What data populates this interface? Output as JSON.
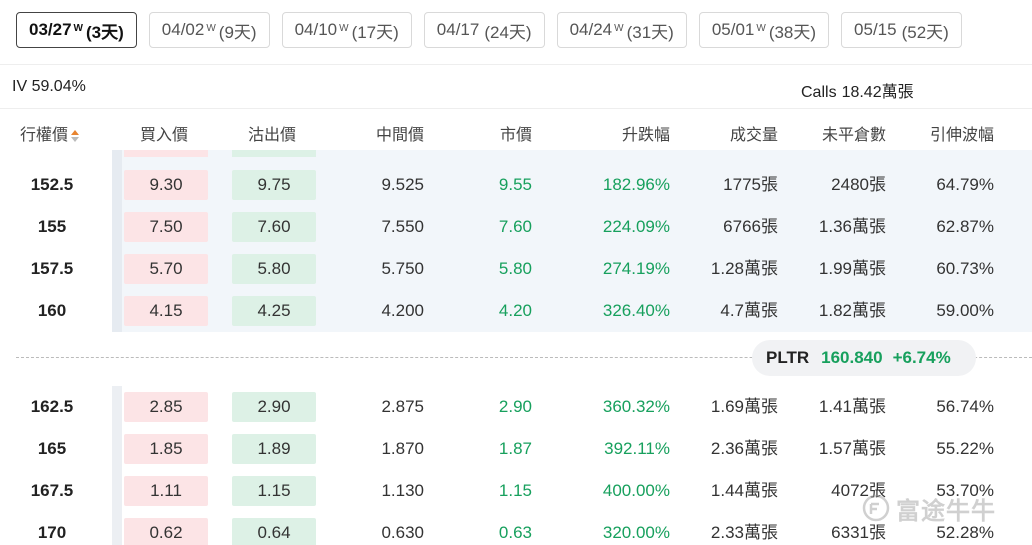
{
  "expiry_tabs": [
    {
      "date": "03/27",
      "weekly": "W",
      "days": "(3天)",
      "active": true
    },
    {
      "date": "04/02",
      "weekly": "W",
      "days": "(9天)",
      "active": false
    },
    {
      "date": "04/10",
      "weekly": "W",
      "days": "(17天)",
      "active": false
    },
    {
      "date": "04/17",
      "weekly": "",
      "days": "(24天)",
      "active": false
    },
    {
      "date": "04/24",
      "weekly": "W",
      "days": "(31天)",
      "active": false
    },
    {
      "date": "05/01",
      "weekly": "W",
      "days": "(38天)",
      "active": false
    },
    {
      "date": "05/15",
      "weekly": "",
      "days": "(52天)",
      "active": false
    }
  ],
  "summary": {
    "iv": "IV 59.04%",
    "calls_label": "Calls",
    "calls_value": "18.42萬張"
  },
  "columns": {
    "strike": "行權價",
    "bid": "買入價",
    "ask": "沽出價",
    "mid": "中間價",
    "last": "市價",
    "change": "升跌幅",
    "volume": "成交量",
    "open_interest": "未平倉數",
    "implied_vol": "引伸波幅"
  },
  "rows_above": [
    {
      "strike": "152.5",
      "bid": "9.30",
      "ask": "9.75",
      "mid": "9.525",
      "last": "9.55",
      "change": "182.96%",
      "volume": "1775張",
      "oi": "2480張",
      "iv": "64.79%"
    },
    {
      "strike": "155",
      "bid": "7.50",
      "ask": "7.60",
      "mid": "7.550",
      "last": "7.60",
      "change": "224.09%",
      "volume": "6766張",
      "oi": "1.36萬張",
      "iv": "62.87%"
    },
    {
      "strike": "157.5",
      "bid": "5.70",
      "ask": "5.80",
      "mid": "5.750",
      "last": "5.80",
      "change": "274.19%",
      "volume": "1.28萬張",
      "oi": "1.99萬張",
      "iv": "60.73%"
    },
    {
      "strike": "160",
      "bid": "4.15",
      "ask": "4.25",
      "mid": "4.200",
      "last": "4.20",
      "change": "326.40%",
      "volume": "4.7萬張",
      "oi": "1.82萬張",
      "iv": "59.00%"
    }
  ],
  "underlying": {
    "symbol": "PLTR",
    "price": "160.840",
    "change": "+6.74%"
  },
  "rows_below": [
    {
      "strike": "162.5",
      "bid": "2.85",
      "ask": "2.90",
      "mid": "2.875",
      "last": "2.90",
      "change": "360.32%",
      "volume": "1.69萬張",
      "oi": "1.41萬張",
      "iv": "56.74%"
    },
    {
      "strike": "165",
      "bid": "1.85",
      "ask": "1.89",
      "mid": "1.870",
      "last": "1.87",
      "change": "392.11%",
      "volume": "2.36萬張",
      "oi": "1.57萬張",
      "iv": "55.22%"
    },
    {
      "strike": "167.5",
      "bid": "1.11",
      "ask": "1.15",
      "mid": "1.130",
      "last": "1.15",
      "change": "400.00%",
      "volume": "1.44萬張",
      "oi": "4072張",
      "iv": "53.70%"
    },
    {
      "strike": "170",
      "bid": "0.62",
      "ask": "0.64",
      "mid": "0.630",
      "last": "0.63",
      "change": "320.00%",
      "volume": "2.33萬張",
      "oi": "6331張",
      "iv": "52.28%"
    }
  ],
  "watermark": "富途牛牛",
  "colors": {
    "up_green": "#17a05d",
    "bid_bg": "#fce4e6",
    "ask_bg": "#ddf1e6",
    "itm_band": "#f2f6fa",
    "sort_active": "#e8842f"
  }
}
